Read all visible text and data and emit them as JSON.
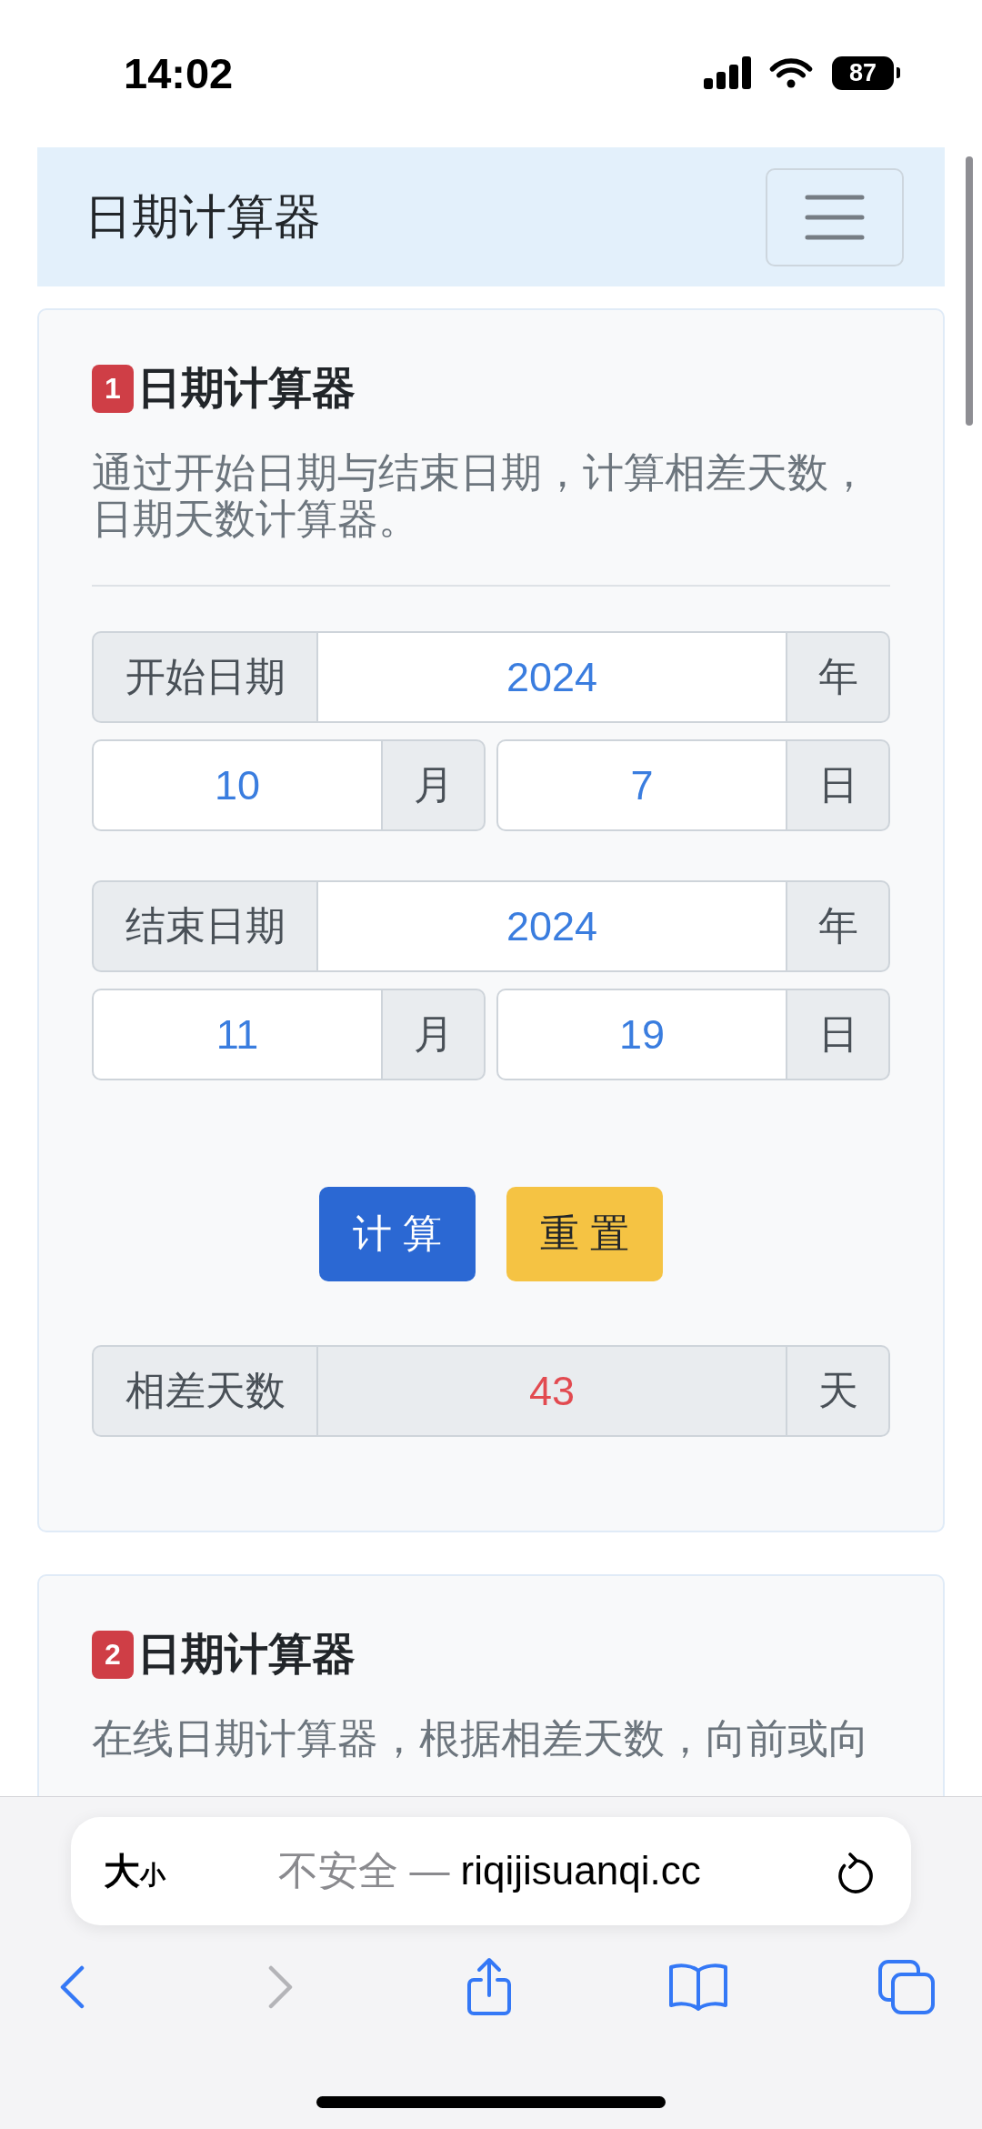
{
  "status_bar": {
    "time": "14:02",
    "battery": "87"
  },
  "navbar": {
    "title": "日期计算器"
  },
  "cards": [
    {
      "number": "1",
      "title": "日期计算器",
      "description": "通过开始日期与结束日期，计算相差天数，日期天数计算器。",
      "date_groups": [
        {
          "label": "开始日期",
          "year": "2024",
          "year_unit": "年",
          "month": "10",
          "month_unit": "月",
          "day": "7",
          "day_unit": "日"
        },
        {
          "label": "结束日期",
          "year": "2024",
          "year_unit": "年",
          "month": "11",
          "month_unit": "月",
          "day": "19",
          "day_unit": "日"
        }
      ],
      "buttons": [
        {
          "kind": "calculate",
          "label": "计 算"
        },
        {
          "kind": "reset",
          "label": "重 置"
        }
      ],
      "result": {
        "label": "相差天数",
        "value": "43",
        "unit": "天"
      }
    },
    {
      "number": "2",
      "title": "日期计算器",
      "description": "在线日期计算器，根据相差天数，向前或向"
    }
  ],
  "address_bar": {
    "text_size": {
      "large": "大",
      "small": "小"
    },
    "security_label": "不安全 —",
    "url": "riqijisuanqi.cc"
  },
  "toolbar": [
    {
      "kind": "back",
      "disabled": false
    },
    {
      "kind": "forward",
      "disabled": true
    },
    {
      "kind": "share",
      "disabled": false
    },
    {
      "kind": "bookmarks",
      "disabled": false
    },
    {
      "kind": "tabs",
      "disabled": false
    }
  ]
}
